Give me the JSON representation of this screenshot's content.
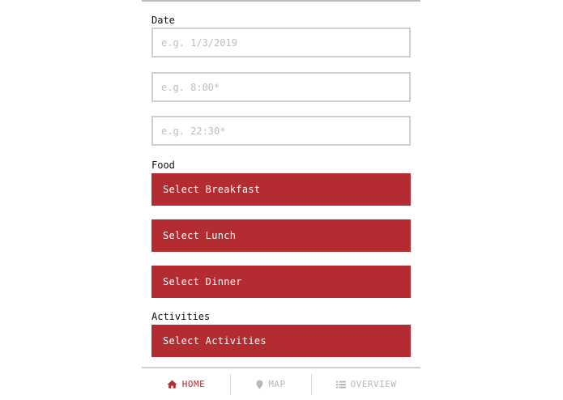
{
  "sections": {
    "date_label": "Date",
    "food_label": "Food",
    "activities_label": "Activities"
  },
  "fields": {
    "date_placeholder": "e.g. 1/3/2019",
    "start_time_placeholder": "e.g. 8:00*",
    "end_time_placeholder": "e.g. 22:30*"
  },
  "buttons": {
    "breakfast": "Select Breakfast",
    "lunch": "Select Lunch",
    "dinner": "Select Dinner",
    "activities": "Select Activities"
  },
  "nav": {
    "home": "HOME",
    "map": "MAP",
    "overview": "OVERVIEW",
    "active": "home"
  },
  "colors": {
    "accent": "#b32c32",
    "inactive": "#b8b8b8",
    "border": "#cfcfcf"
  },
  "icons": {
    "home": "home-icon",
    "map": "map-pin-icon",
    "overview": "list-icon"
  }
}
